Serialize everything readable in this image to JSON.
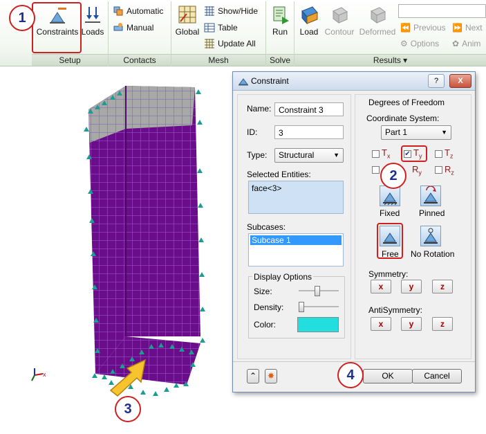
{
  "ribbon": {
    "setup": {
      "label": "Setup",
      "constraints": "Constraints",
      "loads": "Loads"
    },
    "contacts": {
      "label": "Contacts",
      "automatic": "Automatic",
      "manual": "Manual"
    },
    "mesh": {
      "label": "Mesh",
      "global": "Global",
      "show_hide": "Show/Hide",
      "table": "Table",
      "update_all": "Update  All"
    },
    "solve": {
      "label": "Solve",
      "run": "Run"
    },
    "results": {
      "label": "Results ▾",
      "load": "Load",
      "contour": "Contour",
      "deformed": "Deformed",
      "previous": "Previous",
      "next": "Next",
      "options": "Options",
      "anim": "Anim"
    }
  },
  "dialog": {
    "title": "Constraint",
    "help": "?",
    "close": "X",
    "name_label": "Name:",
    "name_value": "Constraint 3",
    "id_label": "ID:",
    "id_value": "3",
    "type_label": "Type:",
    "type_value": "Structural",
    "selected_entities_label": "Selected Entities:",
    "selected_entity": "face<3>",
    "subcases_label": "Subcases:",
    "subcase_item": "Subcase 1",
    "display_options": {
      "title": "Display Options",
      "size": "Size:",
      "density": "Density:",
      "color": "Color:",
      "size_level": 0.45,
      "density_level": 0.0,
      "color_value": "#22dede"
    },
    "dof": {
      "title": "Degrees of Freedom",
      "coord_label": "Coordinate System:",
      "coord_value": "Part 1",
      "tx": "T",
      "tx_sub": "x",
      "tx_checked": false,
      "ty": "T",
      "ty_sub": "y",
      "ty_checked": true,
      "tz": "T",
      "tz_sub": "z",
      "tz_checked": false,
      "rx_checked": false,
      "ry": "R",
      "ry_sub": "y",
      "rz": "R",
      "rz_sub": "z",
      "rz_checked": false,
      "fixed": "Fixed",
      "pinned": "Pinned",
      "free": "Free",
      "no_rotation": "No Rotation",
      "symmetry": "Symmetry:",
      "antisymmetry": "AntiSymmetry:",
      "x": "x",
      "y": "y",
      "z": "z"
    },
    "ok": "OK",
    "cancel": "Cancel"
  },
  "callouts": {
    "c1": "1",
    "c2": "2",
    "c3": "3",
    "c4": "4"
  },
  "colors": {
    "mesh_fill": "#6a0d8a",
    "mesh_top": "#a8a8a8",
    "constraint_marker": "#1f9c92",
    "callout_border": "#d01f1f",
    "arrow": "#f7c430"
  }
}
